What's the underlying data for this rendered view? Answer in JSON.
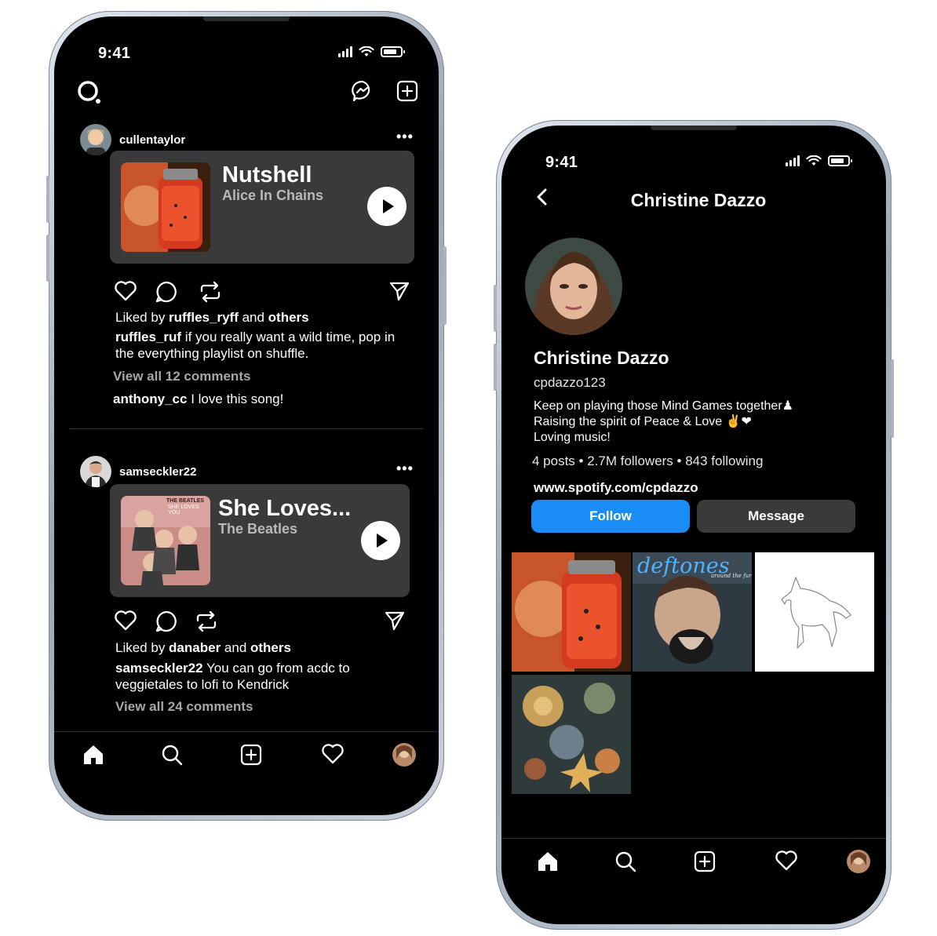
{
  "status": {
    "time": "9:41"
  },
  "feed": {
    "posts": [
      {
        "username": "cullentaylor",
        "more": "•••",
        "song_title": "Nutshell",
        "song_artist": "Alice In Chains",
        "liked_prefix": "Liked by ",
        "liked_user": "ruffles_ryff",
        "liked_and": " and ",
        "liked_others": "others",
        "caption_user": "ruffles_ruf",
        "caption_line1": " if you really want a wild time, pop in",
        "caption_line2": "the everything playlist on shuffle.",
        "view_comments": "View all 12 comments",
        "comment_user": "anthony_cc",
        "comment_text": " I love this song!"
      },
      {
        "username": "samseckler22",
        "more": "•••",
        "song_title": "She Loves...",
        "song_artist": "The Beatles",
        "cover_text_top": "THE BEATLES",
        "cover_text_bottom": "SHE LOVES YOU",
        "liked_prefix": "Liked by ",
        "liked_user": "danaber",
        "liked_and": " and ",
        "liked_others": "others",
        "caption_user": "samseckler22",
        "caption_line1": " You can go from acdc to",
        "caption_line2": "veggietales to lofi to Kendrick",
        "view_comments": "View all 24 comments"
      }
    ]
  },
  "profile": {
    "header_title": "Christine Dazzo",
    "name": "Christine Dazzo",
    "handle": "cpdazzo123",
    "bio_line1": "Keep on playing those Mind Games together♟",
    "bio_line2": "Raising the spirit of Peace & Love ✌️❤",
    "bio_line3": "Loving music!",
    "stats": "4 posts • 2.7M followers • 843 following",
    "link": "www.spotify.com/cpdazzo",
    "follow_label": "Follow",
    "message_label": "Message",
    "grid_text": "deftones",
    "grid_subtext": "around the fur"
  },
  "colors": {
    "follow": "#1a8cf5",
    "message": "#3a3a3a"
  }
}
